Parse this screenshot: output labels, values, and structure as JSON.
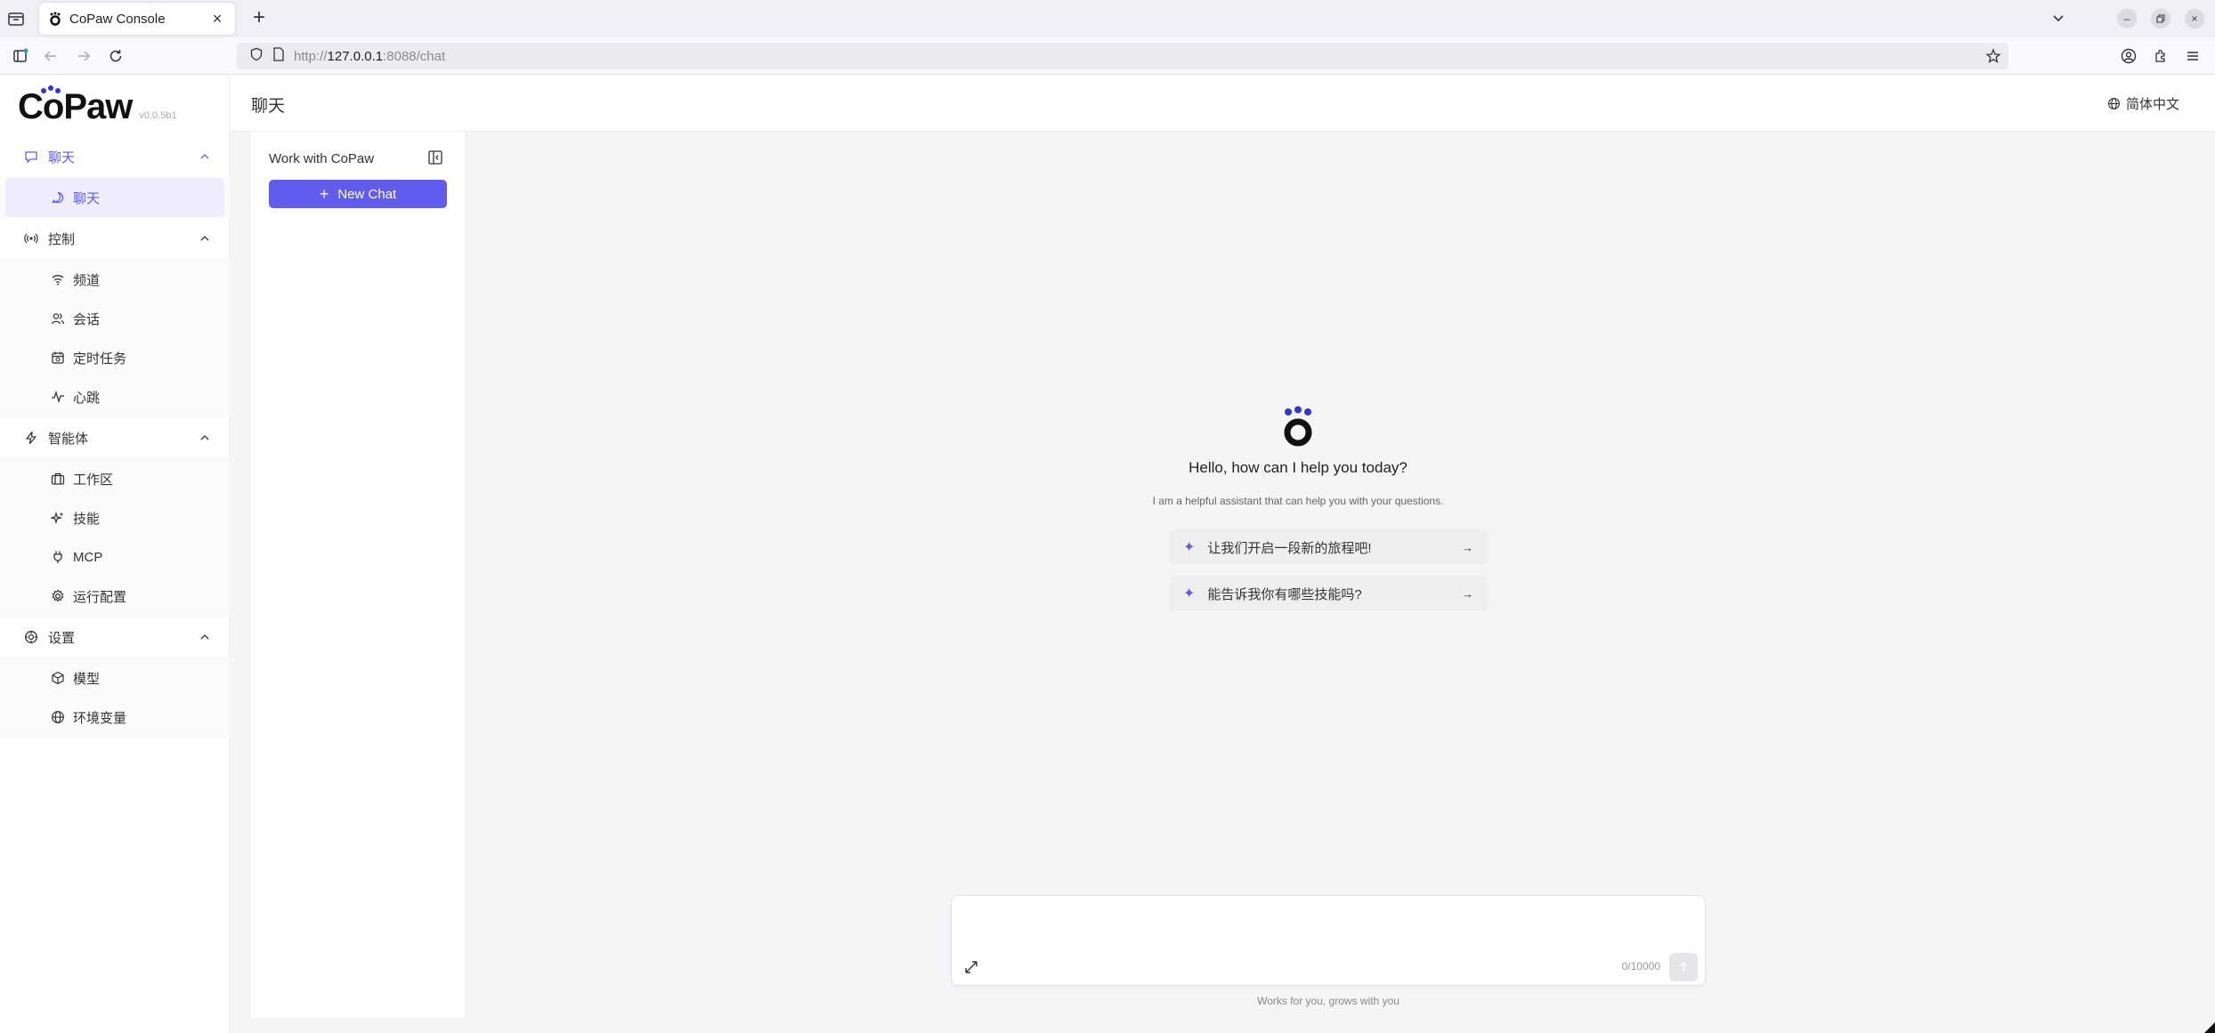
{
  "browser": {
    "tab_title": "CoPaw Console",
    "url_prefix": "http://",
    "url_host": "127.0.0.1",
    "url_rest": ":8088/chat",
    "icons": [
      "tab-list-icon",
      "copaw-favicon",
      "close-icon",
      "plus-icon",
      "chevron-down-icon",
      "minimize-icon",
      "restore-icon",
      "close-window-icon",
      "sidebar-toggle-icon",
      "back-icon",
      "forward-icon",
      "reload-icon",
      "shield-icon",
      "page-icon",
      "star-icon",
      "account-icon",
      "extensions-icon",
      "menu-icon"
    ]
  },
  "app": {
    "logo_text": "CoPaw",
    "version": "v0.0.5b1",
    "brand_color": "#615ced"
  },
  "sidebar": {
    "groups": [
      {
        "label": "聊天",
        "icon": "chat-bubble-icon",
        "items": [
          {
            "label": "聊天",
            "icon": "chat-icon",
            "active": true
          }
        ]
      },
      {
        "label": "控制",
        "icon": "broadcast-icon",
        "items": [
          {
            "label": "频道",
            "icon": "wifi-icon"
          },
          {
            "label": "会话",
            "icon": "users-icon"
          },
          {
            "label": "定时任务",
            "icon": "calendar-clock-icon"
          },
          {
            "label": "心跳",
            "icon": "pulse-icon"
          }
        ]
      },
      {
        "label": "智能体",
        "icon": "bolt-icon",
        "items": [
          {
            "label": "工作区",
            "icon": "briefcase-icon"
          },
          {
            "label": "技能",
            "icon": "sparkles-icon"
          },
          {
            "label": "MCP",
            "icon": "plug-icon"
          },
          {
            "label": "运行配置",
            "icon": "gear-icon"
          }
        ]
      },
      {
        "label": "设置",
        "icon": "settings-icon",
        "items": [
          {
            "label": "模型",
            "icon": "cube-icon"
          },
          {
            "label": "环境变量",
            "icon": "globe-icon"
          }
        ]
      }
    ]
  },
  "header": {
    "title": "聊天",
    "language": "简体中文"
  },
  "chatlist": {
    "title": "Work with CoPaw",
    "new_chat_label": "New Chat"
  },
  "welcome": {
    "title": "Hello, how can I help you today?",
    "subtitle": "I am a helpful assistant that can help you with your questions.",
    "prompts": [
      "让我们开启一段新的旅程吧!",
      "能告诉我你有哪些技能吗?"
    ]
  },
  "composer": {
    "counter": "0/10000",
    "footer": "Works for you, grows with you"
  }
}
